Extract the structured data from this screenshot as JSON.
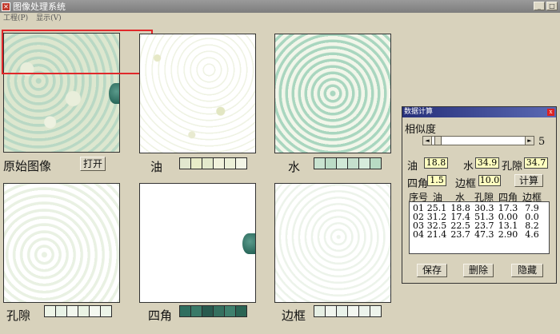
{
  "window": {
    "title": "图像处理系统",
    "app_icon_glyph": "✕"
  },
  "menu": {
    "items": [
      "工程(P)",
      "显示(V)"
    ]
  },
  "window_buttons": {
    "minimize": "_",
    "maximize": "□"
  },
  "panels": {
    "original": {
      "label": "原始图像",
      "button": "打开"
    },
    "oil": {
      "label": "油",
      "swatches": [
        "#e2e8cf",
        "#e8ecc8",
        "#e4eacc",
        "#f1f2dc",
        "#ecf0d8",
        "#f3f5e6"
      ]
    },
    "water": {
      "label": "水",
      "swatches": [
        "#c9e3d0",
        "#bcdcc6",
        "#d0e8d6",
        "#c5e0cd",
        "#d6ebdc",
        "#b8dac3"
      ]
    },
    "pore": {
      "label": "孔隙",
      "swatches": [
        "#eef5e8",
        "#e8f2e6",
        "#f2f7ee",
        "#eaf3e4",
        "#f4f8f0",
        "#ecf4e8"
      ]
    },
    "corner": {
      "label": "四角",
      "swatches": [
        "#2f6f5f",
        "#3a7a68",
        "#285a4e",
        "#35705f",
        "#3f806d",
        "#2a6453"
      ]
    },
    "edge": {
      "label": "边框",
      "swatches": [
        "#e6efe4",
        "#f0f5ee",
        "#e9f2ea",
        "#f3f7f1",
        "#ecf3ec",
        "#eef4ec"
      ]
    }
  },
  "dialog": {
    "title": "数据计算",
    "close_glyph": "x",
    "similarity_label": "相似度",
    "similarity_value": "5",
    "slider_left": "◄",
    "slider_right": "►",
    "fields": {
      "oil_label": "油",
      "oil_value": "18.8",
      "water_label": "水",
      "water_value": "34.9",
      "pore_label": "孔隙",
      "pore_value": "34.7",
      "corner_label": "四角",
      "corner_value": "1.5",
      "edge_label": "边框",
      "edge_value": "10.0"
    },
    "calc_button": "计算",
    "table": {
      "headers": [
        "序号",
        "油",
        "水",
        "孔隙",
        "四角",
        "边框"
      ],
      "rows": [
        [
          "01",
          "25.1",
          "18.8",
          "30.3",
          "17.3",
          "7.9"
        ],
        [
          "02",
          "31.2",
          "17.4",
          "51.3",
          "0.00",
          "0.0"
        ],
        [
          "03",
          "32.5",
          "22.5",
          "23.7",
          "13.1",
          "8.2"
        ],
        [
          "04",
          "21.4",
          "23.7",
          "47.3",
          "2.90",
          "4.6"
        ]
      ]
    },
    "save_button": "保存",
    "delete_button": "删除",
    "hide_button": "隐藏"
  }
}
